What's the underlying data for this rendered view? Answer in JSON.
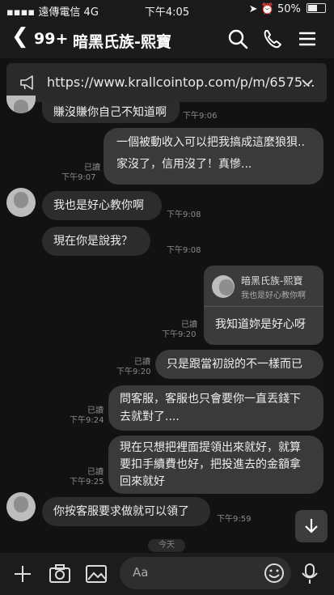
{
  "status": {
    "carrier": "遠傳電信",
    "network": "4G",
    "time": "下午4:05",
    "battery": "50%"
  },
  "header": {
    "unread_count": "99+",
    "title": "暗黑氏族-熙寶"
  },
  "banner": {
    "url": "https://www.krallcointop.com/p/m/6575..."
  },
  "messages": {
    "m1": {
      "text": "賺沒賺你自己不知道啊",
      "time": "下午9:06"
    },
    "m2": {
      "line1": "一個被動收入可以把我搞成這麼狼狽..",
      "line2": "家沒了，信用沒了！真慘...",
      "time": "下午9:07",
      "read": "已讀"
    },
    "m3": {
      "text": "我也是好心教你啊",
      "time": "下午9:08"
    },
    "m4": {
      "text": "現在你是說我？",
      "time": "下午9:08"
    },
    "m5": {
      "quote_name": "暗黑氏族-熙寶",
      "quote_text": "我也是好心教你啊",
      "text": "我知道妳是好心呀",
      "time": "下午9:20",
      "read": "已讀"
    },
    "m6": {
      "text": "只是跟當初說的不一樣而已",
      "time": "下午9:20",
      "read": "已讀"
    },
    "m7": {
      "line1": "問客服，客服也只會要你一直丟錢下",
      "line2": "去就對了....",
      "time": "下午9:24",
      "read": "已讀"
    },
    "m8": {
      "line1": "現在只想把裡面提領出來就好，就算",
      "line2": "要扣手續費也好，把投進去的金額拿",
      "line3": "回來就好",
      "time": "下午9:25",
      "read": "已讀"
    },
    "m9": {
      "text": "你按客服要求做就可以領了",
      "time": "下午9:59"
    }
  },
  "date_chip": "今天",
  "footer": {
    "placeholder": "Aa"
  },
  "icons": [
    "back-icon",
    "search-icon",
    "phone-icon",
    "menu-icon",
    "megaphone-icon",
    "chevron-down-icon",
    "plus-icon",
    "camera-icon",
    "image-icon",
    "emoji-icon",
    "mic-icon",
    "scroll-down-icon"
  ]
}
